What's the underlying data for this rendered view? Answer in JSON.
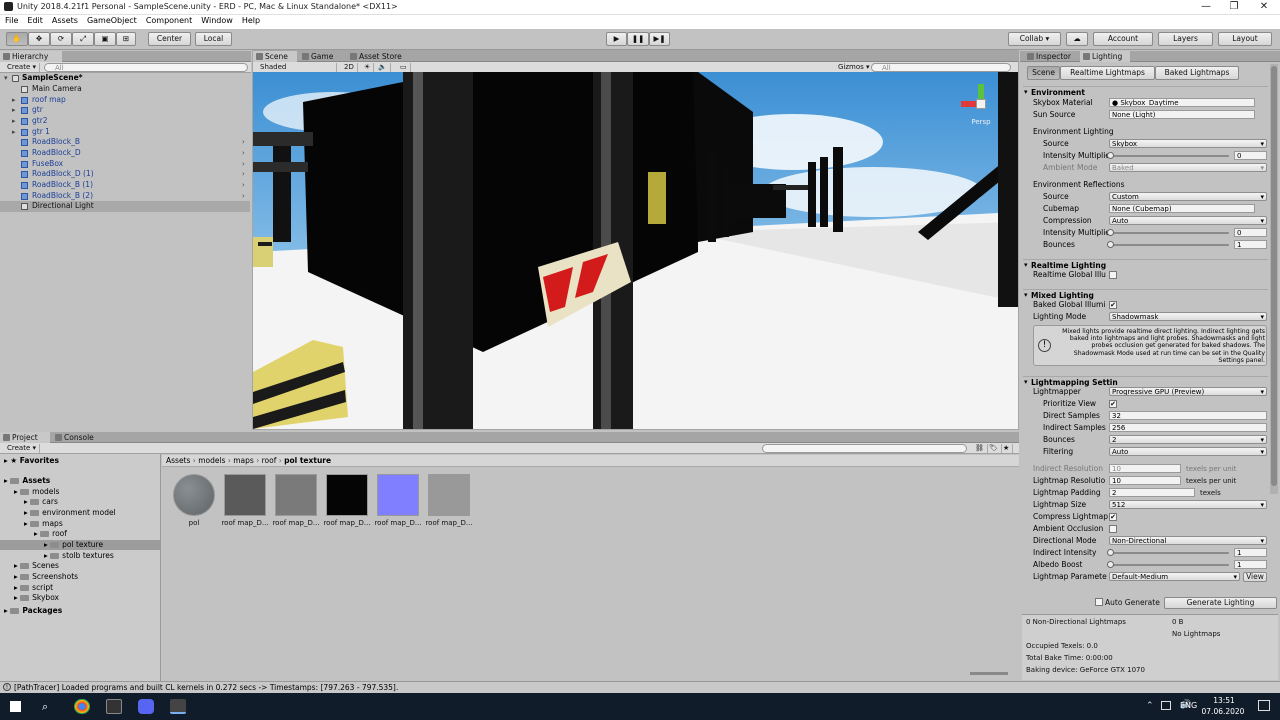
{
  "window": {
    "title": "Unity 2018.4.21f1 Personal - SampleScene.unity - ERD - PC, Mac & Linux Standalone* <DX11>",
    "minimize": "—",
    "maximize": "❐",
    "close": "✕"
  },
  "menu": [
    "File",
    "Edit",
    "Assets",
    "GameObject",
    "Component",
    "Window",
    "Help"
  ],
  "toolbar": {
    "center": "Center",
    "local": "Local",
    "collab": "Collab ▾",
    "account": "Account",
    "layers": "Layers",
    "layout": "Layout",
    "play": "▶",
    "pause": "❚❚",
    "step": "▶❚"
  },
  "hierarchy": {
    "tab": "Hierarchy",
    "create": "Create ▾",
    "search_placeholder": "All",
    "scene": "SampleScene*",
    "items": [
      {
        "name": "Main Camera",
        "prefab": false,
        "expand": false
      },
      {
        "name": "roof map",
        "prefab": true,
        "expand": true
      },
      {
        "name": "gtr",
        "prefab": true,
        "expand": true
      },
      {
        "name": "gtr2",
        "prefab": true,
        "expand": true
      },
      {
        "name": "gtr 1",
        "prefab": true,
        "expand": true
      },
      {
        "name": "RoadBlock_B",
        "prefab": true,
        "expand": false
      },
      {
        "name": "RoadBlock_D",
        "prefab": true,
        "expand": false
      },
      {
        "name": "FuseBox",
        "prefab": true,
        "expand": false
      },
      {
        "name": "RoadBlock_D (1)",
        "prefab": true,
        "expand": false
      },
      {
        "name": "RoadBlock_B (1)",
        "prefab": true,
        "expand": false
      },
      {
        "name": "RoadBlock_B (2)",
        "prefab": true,
        "expand": false
      },
      {
        "name": "Directional Light",
        "prefab": false,
        "expand": false
      }
    ]
  },
  "sceneview": {
    "tabs": [
      "Scene",
      "Game",
      "Asset Store"
    ],
    "shading": "Shaded",
    "mode2d": "2D",
    "gizmos": "Gizmos ▾",
    "search_placeholder": "All",
    "persp": "Persp"
  },
  "project": {
    "tabs": [
      "Project",
      "Console"
    ],
    "create": "Create ▾",
    "favorites": "Favorites",
    "tree": [
      {
        "label": "Assets",
        "depth": 0,
        "bold": true
      },
      {
        "label": "models",
        "depth": 1
      },
      {
        "label": "cars",
        "depth": 2
      },
      {
        "label": "environment model",
        "depth": 2
      },
      {
        "label": "maps",
        "depth": 2
      },
      {
        "label": "roof",
        "depth": 3
      },
      {
        "label": "pol texture",
        "depth": 4,
        "selected": true
      },
      {
        "label": "stolb textures",
        "depth": 4
      },
      {
        "label": "Scenes",
        "depth": 1
      },
      {
        "label": "Screenshots",
        "depth": 1
      },
      {
        "label": "script",
        "depth": 1
      },
      {
        "label": "Skybox",
        "depth": 1
      },
      {
        "label": "Packages",
        "depth": 0,
        "bold": true
      }
    ],
    "breadcrumb": [
      "Assets",
      "models",
      "maps",
      "roof",
      "pol texture"
    ],
    "assets": [
      {
        "label": "pol",
        "color": "#5e6366"
      },
      {
        "label": "roof map_D...",
        "color": "#5a5a5a"
      },
      {
        "label": "roof map_D...",
        "color": "#7a7a7a"
      },
      {
        "label": "roof map_D...",
        "color": "#050505"
      },
      {
        "label": "roof map_D...",
        "color": "#7f7fff"
      },
      {
        "label": "roof map_D...",
        "color": "#999999"
      }
    ]
  },
  "status": "[PathTracer] Loaded programs and built CL kernels in 0.272 secs -> Timestamps: [797.263 - 797.535].",
  "inspector": {
    "tabs": [
      "Inspector",
      "Lighting"
    ],
    "subtabs": [
      "Scene",
      "Realtime Lightmaps",
      "Baked Lightmaps"
    ],
    "environment": {
      "header": "Environment",
      "skybox_label": "Skybox Material",
      "skybox": "Skybox_Daytime",
      "sun_label": "Sun Source",
      "sun": "None (Light)",
      "lighting_label": "Environment Lighting",
      "source_label": "Source",
      "source": "Skybox",
      "intensity_label": "Intensity Multiplie",
      "intensity": "0",
      "ambient_label": "Ambient Mode",
      "ambient": "Baked",
      "refl_label": "Environment Reflections",
      "rsource_label": "Source",
      "rsource": "Custom",
      "cubemap_label": "Cubemap",
      "cubemap": "None (Cubemap)",
      "compression_label": "Compression",
      "compression": "Auto",
      "rintensity_label": "Intensity Multiplie",
      "rintensity": "0",
      "bounces_label": "Bounces",
      "bounces": "1"
    },
    "realtime": {
      "header": "Realtime Lighting",
      "gi_label": "Realtime Global Illu"
    },
    "mixed": {
      "header": "Mixed Lighting",
      "baked_label": "Baked Global Illumi",
      "mode_label": "Lighting Mode",
      "mode": "Shadowmask",
      "info": "Mixed lights provide realtime direct lighting. Indirect lighting gets baked into lightmaps and light probes. Shadowmasks and light probes occlusion get generated for baked shadows. The Shadowmask Mode used at run time can be set in the Quality Settings panel."
    },
    "lightmapping": {
      "header": "Lightmapping Settin",
      "lightmapper_label": "Lightmapper",
      "lightmapper": "Progressive GPU (Preview)",
      "prioritize_label": "Prioritize View",
      "direct_label": "Direct Samples",
      "direct": "32",
      "indirect_label": "Indirect Samples",
      "indirect": "256",
      "bounces_label": "Bounces",
      "bounces": "2",
      "filtering_label": "Filtering",
      "filtering": "Auto",
      "ires_label": "Indirect Resolution",
      "ires": "10",
      "ires_unit": "texels per unit",
      "lres_label": "Lightmap Resolutio",
      "lres": "10",
      "lres_unit": "texels per unit",
      "pad_label": "Lightmap Padding",
      "pad": "2",
      "pad_unit": "texels",
      "size_label": "Lightmap Size",
      "size": "512",
      "compress_label": "Compress Lightmap",
      "ao_label": "Ambient Occlusion",
      "dir_label": "Directional Mode",
      "dir": "Non-Directional",
      "iint_label": "Indirect Intensity",
      "iint": "1",
      "albedo_label": "Albedo Boost",
      "albedo": "1",
      "params_label": "Lightmap Paramete",
      "params": "Default-Medium",
      "view": "View"
    },
    "auto_generate": "Auto Generate",
    "generate": "Generate Lighting",
    "stats": {
      "lightmaps": "0 Non-Directional Lightmaps",
      "size": "0 B",
      "none": "No Lightmaps",
      "texels": "Occupied Texels: 0.0",
      "bake": "Total Bake Time: 0:00:00",
      "device": "Baking device: GeForce GTX 1070"
    }
  },
  "taskbar": {
    "lang": "ENG",
    "time": "13:51",
    "date": "07.06.2020"
  }
}
